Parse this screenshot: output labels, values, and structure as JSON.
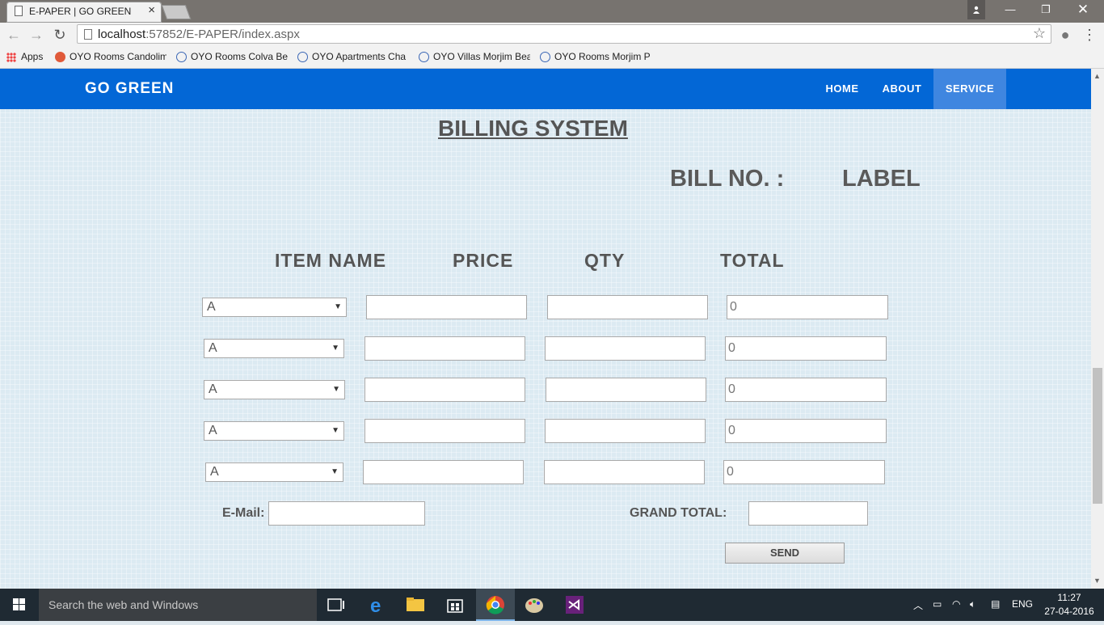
{
  "browser": {
    "tab_title": "E-PAPER | GO GREEN",
    "url_host": "localhost",
    "url_rest": ":57852/E-PAPER/index.aspx",
    "bookmarks": [
      {
        "label": "Apps"
      },
      {
        "label": "OYO Rooms Candolim"
      },
      {
        "label": "OYO Rooms Colva Bea"
      },
      {
        "label": "OYO Apartments Cha"
      },
      {
        "label": "OYO Villas Morjim Bea"
      },
      {
        "label": "OYO Rooms Morjim P"
      }
    ]
  },
  "navbar": {
    "brand": "GO GREEN",
    "links": [
      "HOME",
      "ABOUT",
      "SERVICE"
    ],
    "active": "SERVICE"
  },
  "billing": {
    "heading": "BILLING SYSTEM",
    "bill_no_label": "BILL NO. :",
    "bill_no_value": "LABEL",
    "columns": [
      "ITEM NAME",
      "PRICE",
      "QTY",
      "TOTAL"
    ],
    "rows": [
      {
        "item": "A",
        "price": "",
        "qty": "",
        "total": "0"
      },
      {
        "item": "A",
        "price": "",
        "qty": "",
        "total": "0"
      },
      {
        "item": "A",
        "price": "",
        "qty": "",
        "total": "0"
      },
      {
        "item": "A",
        "price": "",
        "qty": "",
        "total": "0"
      },
      {
        "item": "A",
        "price": "",
        "qty": "",
        "total": "0"
      }
    ],
    "email_label": "E-Mail:",
    "email_value": "",
    "grand_total_label": "GRAND TOTAL:",
    "grand_total_value": "",
    "send_label": "SEND"
  },
  "taskbar": {
    "search_placeholder": "Search the web and Windows",
    "language": "ENG",
    "time": "11:27",
    "date": "27-04-2016"
  },
  "colors": {
    "navbar": "#0367d6",
    "navbar_active": "#3f86e0"
  }
}
